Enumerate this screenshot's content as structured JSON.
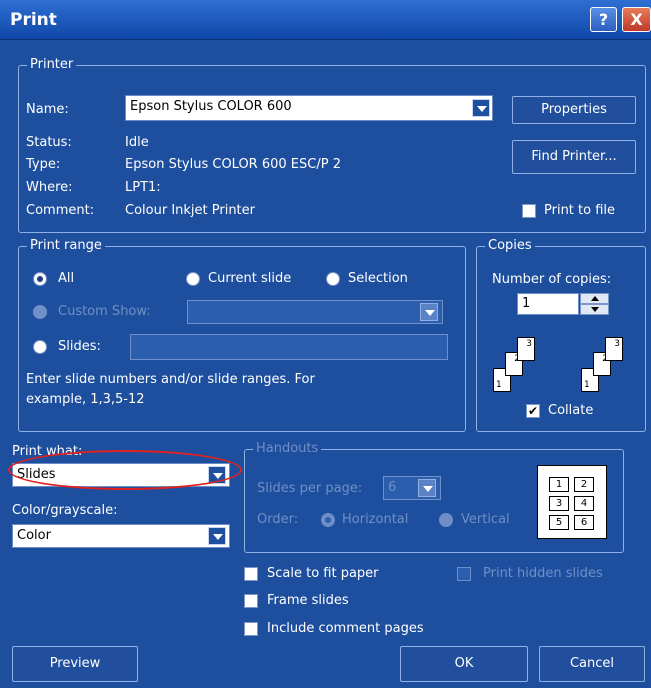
{
  "window": {
    "title": "Print",
    "help_btn": "?",
    "close_btn": "X"
  },
  "printer": {
    "legend": "Printer",
    "name_label": "Name:",
    "name_value": "Epson Stylus COLOR 600",
    "status_label": "Status:",
    "status_value": "Idle",
    "type_label": "Type:",
    "type_value": "Epson Stylus COLOR 600 ESC/P 2",
    "where_label": "Where:",
    "where_value": "LPT1:",
    "comment_label": "Comment:",
    "comment_value": "Colour Inkjet Printer",
    "properties_btn": "Properties",
    "find_printer_btn": "Find Printer...",
    "print_to_file_label": "Print to file",
    "print_to_file_checked": false
  },
  "print_range": {
    "legend": "Print range",
    "all_label": "All",
    "current_slide_label": "Current slide",
    "selection_label": "Selection",
    "custom_show_label": "Custom Show:",
    "slides_label": "Slides:",
    "slides_value": "",
    "hint": "Enter slide numbers and/or slide ranges. For example, 1,3,5-12",
    "selected": "All"
  },
  "copies": {
    "legend": "Copies",
    "count_label": "Number of copies:",
    "count_value": "1",
    "collate_label": "Collate",
    "collate_checked": true,
    "stack_labels": [
      "1",
      "2",
      "3"
    ]
  },
  "print_what": {
    "label": "Print what:",
    "value": "Slides"
  },
  "color": {
    "label": "Color/grayscale:",
    "value": "Color"
  },
  "handouts": {
    "legend": "Handouts",
    "per_page_label": "Slides per page:",
    "per_page_value": "6",
    "order_label": "Order:",
    "horizontal_label": "Horizontal",
    "vertical_label": "Vertical",
    "preview_numbers": [
      "1",
      "2",
      "3",
      "4",
      "5",
      "6"
    ]
  },
  "options": {
    "scale_to_fit": "Scale to fit paper",
    "frame_slides": "Frame slides",
    "include_comments": "Include comment pages",
    "print_hidden": "Print hidden slides"
  },
  "buttons": {
    "preview": "Preview",
    "ok": "OK",
    "cancel": "Cancel"
  },
  "colors": {
    "dialog_bg": "#1e4f9e",
    "titlebar": "#2f6fd3",
    "annotation": "#e0211f"
  }
}
